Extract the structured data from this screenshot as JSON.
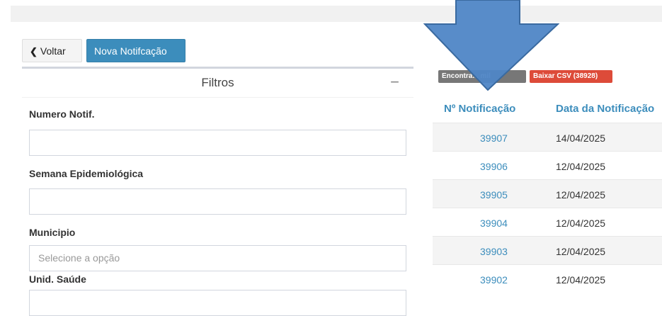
{
  "toolbar": {
    "back_label": "Voltar",
    "new_label": "Nova Notifcação"
  },
  "filters": {
    "title": "Filtros",
    "collapse_symbol": "−",
    "fields": {
      "numero_notif": {
        "label": "Numero Notif.",
        "value": ""
      },
      "semana": {
        "label": "Semana Epidemiológica",
        "value": ""
      },
      "municipio": {
        "label": "Municipio",
        "placeholder": "Selecione a opção"
      },
      "unid_saude": {
        "label": "Unid. Saúde"
      }
    }
  },
  "results": {
    "found_badge": "Encontra... mil",
    "csv_badge": "Baixar CSV (38928)",
    "columns": [
      "Nº Notificação",
      "Data da Notificação"
    ],
    "rows": [
      {
        "id": "39907",
        "date": "14/04/2025"
      },
      {
        "id": "39906",
        "date": "12/04/2025"
      },
      {
        "id": "39905",
        "date": "12/04/2025"
      },
      {
        "id": "39904",
        "date": "12/04/2025"
      },
      {
        "id": "39903",
        "date": "12/04/2025"
      },
      {
        "id": "39902",
        "date": "12/04/2025"
      }
    ]
  },
  "colors": {
    "primary": "#3c8dbc",
    "danger": "#dd4b39",
    "badge_gray": "#777777",
    "annotation_arrow": "#4f86c6"
  },
  "icons": {
    "back": "chevron-left-icon",
    "collapse": "minus-icon",
    "annotation": "down-arrow-annotation"
  }
}
